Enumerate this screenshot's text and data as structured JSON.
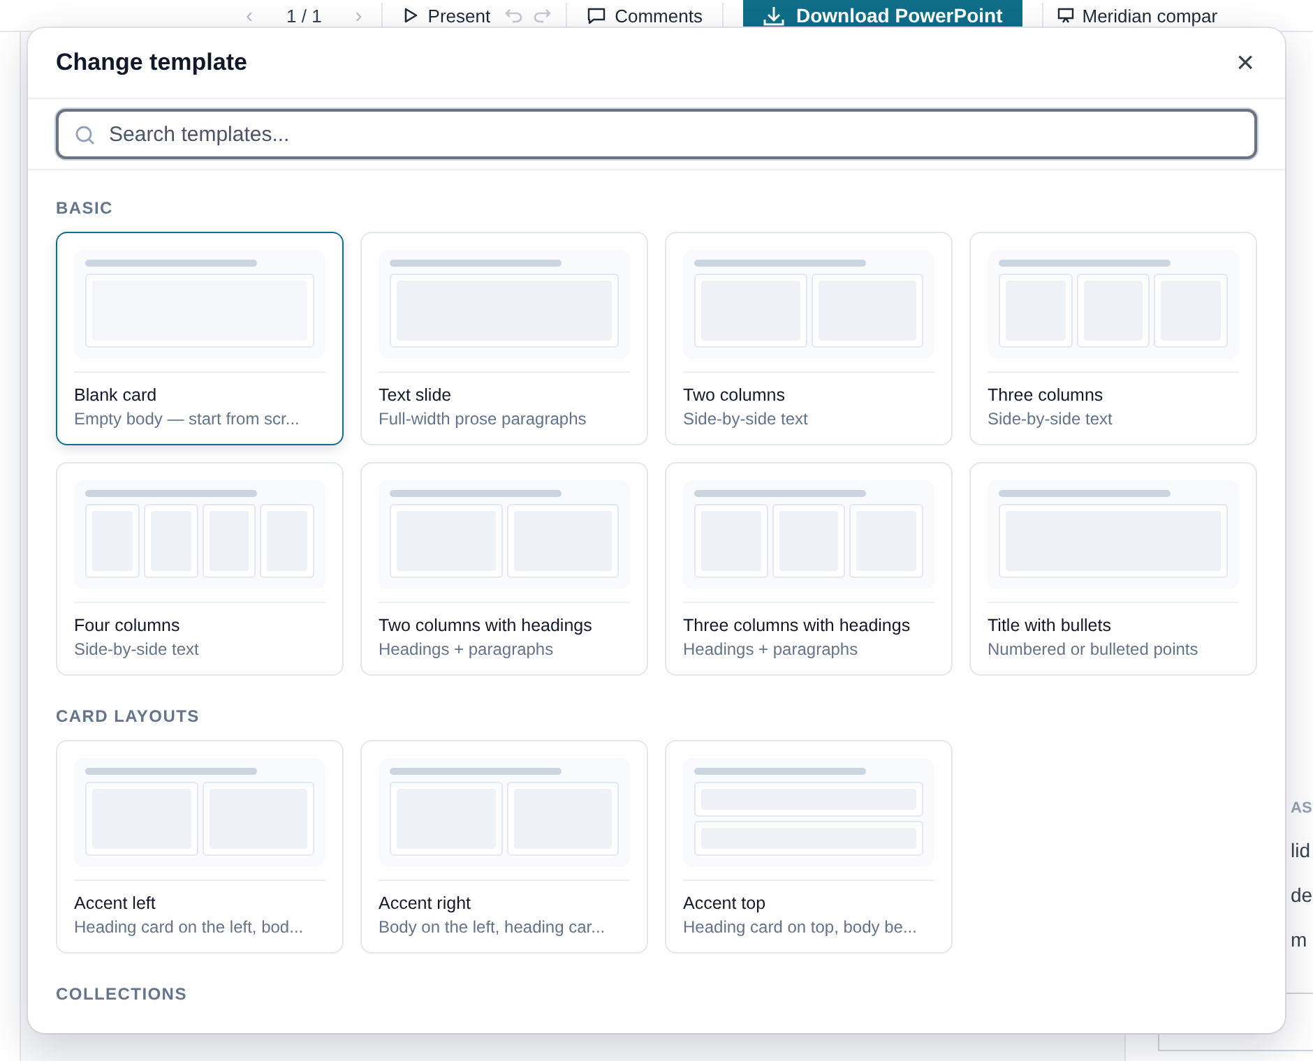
{
  "toolbar": {
    "prev": "‹",
    "page": "1 / 1",
    "next": "›",
    "present": "Present",
    "comments": "Comments",
    "download": "Download PowerPoint",
    "document": "Meridian compar"
  },
  "side_panel": {
    "heading": "AS",
    "items": [
      "lid",
      "de",
      "m"
    ]
  },
  "dialog": {
    "title": "Change template",
    "close": "×",
    "search": {
      "placeholder": "Search templates..."
    },
    "sections": [
      {
        "label": "BASIC",
        "cards": [
          {
            "title": "Blank card",
            "description": "Empty body — start from scr...",
            "kind": "blank",
            "selected": true
          },
          {
            "title": "Text slide",
            "description": "Full-width prose paragraphs",
            "kind": "single",
            "selected": false
          },
          {
            "title": "Two columns",
            "description": "Side-by-side text",
            "kind": "two",
            "selected": false
          },
          {
            "title": "Three columns",
            "description": "Side-by-side text",
            "kind": "three",
            "selected": false
          },
          {
            "title": "Four columns",
            "description": "Side-by-side text",
            "kind": "four",
            "selected": false
          },
          {
            "title": "Two columns with headings",
            "description": "Headings + paragraphs",
            "kind": "two",
            "selected": false
          },
          {
            "title": "Three columns with headings",
            "description": "Headings + paragraphs",
            "kind": "three",
            "selected": false
          },
          {
            "title": "Title with bullets",
            "description": "Numbered or bulleted points",
            "kind": "single",
            "selected": false
          }
        ]
      },
      {
        "label": "CARD LAYOUTS",
        "cards": [
          {
            "title": "Accent left",
            "description": "Heading card on the left, bod...",
            "kind": "split",
            "selected": false
          },
          {
            "title": "Accent right",
            "description": "Body on the left, heading car...",
            "kind": "split",
            "selected": false
          },
          {
            "title": "Accent top",
            "description": "Heading card on top, body be...",
            "kind": "stacked",
            "selected": false
          }
        ]
      },
      {
        "label": "COLLECTIONS"
      }
    ]
  }
}
